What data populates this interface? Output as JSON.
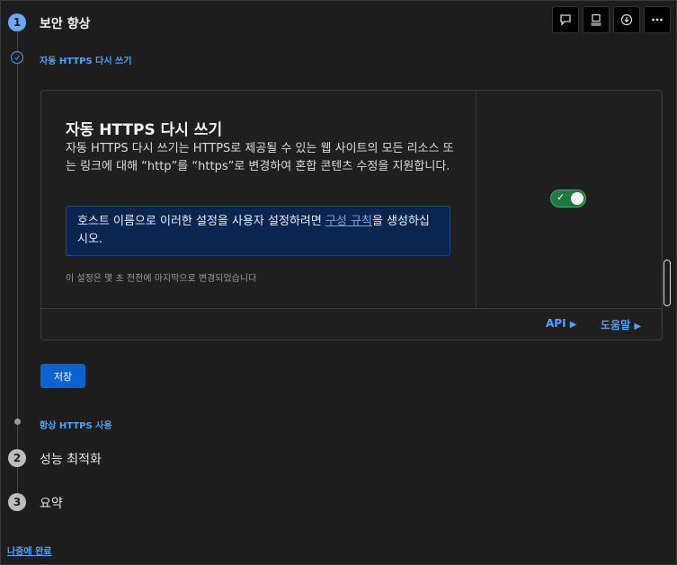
{
  "toolbar": {
    "icons": [
      "comment-icon",
      "feedback-icon",
      "download-icon",
      "more-icon"
    ]
  },
  "steps": [
    {
      "number": "1",
      "title": "보안 향상"
    },
    {
      "number": "2",
      "title": "성능 최적화"
    },
    {
      "number": "3",
      "title": "요약"
    }
  ],
  "substeps": {
    "current": "자동 HTTPS 다시 쓰기",
    "next": "항상 HTTPS 사용"
  },
  "card": {
    "title": "자동 HTTPS 다시 쓰기",
    "description": "자동 HTTPS 다시 쓰기는 HTTPS로 제공될 수 있는 웹 사이트의 모든 리소스 또는 링크에 대해 “http”를 “https”로 변경하여 혼합 콘텐츠 수정을 지원합니다.",
    "info_prefix": "호스트 이름으로 이러한 설정을 사용자 설정하려면 ",
    "info_link": "구성 규칙",
    "info_suffix": "을 생성하십시오.",
    "last_changed": "이 설정은 몇 초 전전에 마지막으로 변경되었습니다",
    "toggle_on": true,
    "api_link": "API",
    "help_link": "도움말"
  },
  "save_label": "저장",
  "later_label": "나중에 완료",
  "colors": {
    "accent": "#4ea3ff",
    "toggle": "#1e7a3c",
    "info_bg": "#0a2550",
    "save": "#0b63d1"
  }
}
